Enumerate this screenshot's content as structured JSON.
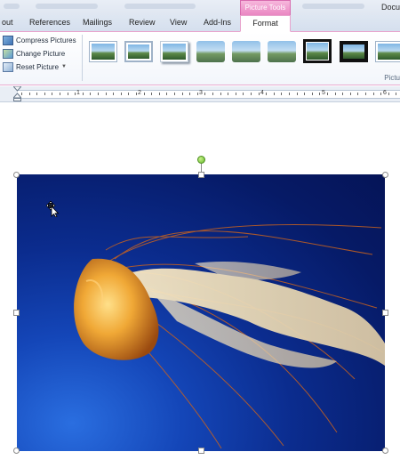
{
  "window": {
    "doc_title": "Docu",
    "context_tab": "Picture Tools"
  },
  "tabs": [
    {
      "label": "out"
    },
    {
      "label": "References"
    },
    {
      "label": "Mailings"
    },
    {
      "label": "Review"
    },
    {
      "label": "View"
    },
    {
      "label": "Add-Ins"
    },
    {
      "label": "Format",
      "active": true
    }
  ],
  "ribbon": {
    "adjust": {
      "compress": "Compress Pictures",
      "change": "Change Picture",
      "reset": "Reset Picture"
    },
    "group_label": "Pictu",
    "picture_styles": [
      {
        "style": "simple-frame"
      },
      {
        "style": "simple-frame-white"
      },
      {
        "style": "drop-shadow"
      },
      {
        "style": "soft-edge"
      },
      {
        "style": "reflected"
      },
      {
        "style": "soft-rounded"
      },
      {
        "style": "thick-black-frame"
      },
      {
        "style": "black-frame"
      },
      {
        "style": "bevel-frame"
      }
    ]
  },
  "ruler": {
    "numbers": [
      "1",
      "2",
      "3",
      "4",
      "5",
      "6"
    ]
  },
  "document": {
    "picture": {
      "subject": "jellyfish",
      "colors": {
        "background": "#0b2c8e",
        "jelly_body": "#e39a2a",
        "tentacles": "#efe2c6"
      },
      "selected": true
    },
    "cursor": "move-cursor"
  }
}
